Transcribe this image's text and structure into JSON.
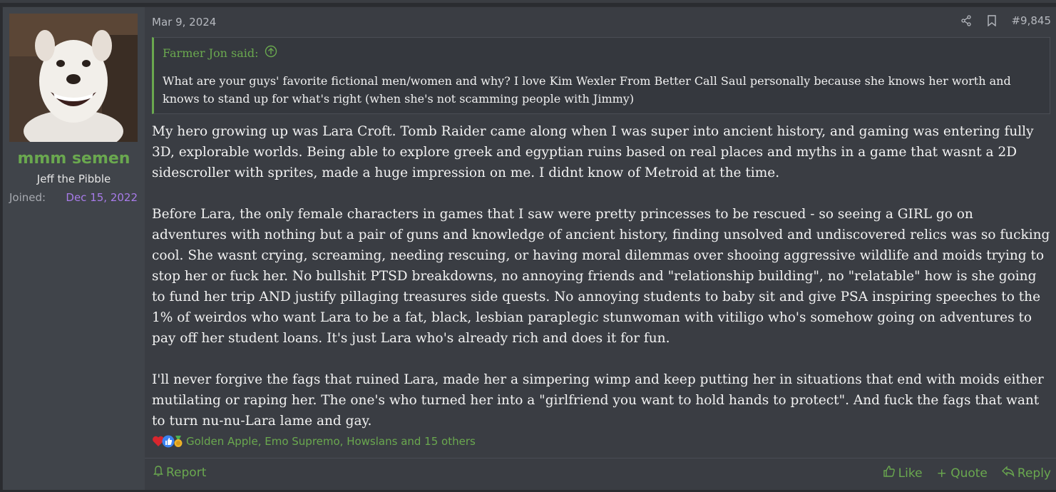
{
  "user": {
    "username": "mmm semen",
    "title": "Jeff the Pibble",
    "joined_label": "Joined:",
    "joined_date": "Dec 15, 2022"
  },
  "post": {
    "date": "Mar 9, 2024",
    "number": "#9,845",
    "quote": {
      "author": "Farmer Jon said:",
      "text": "What are your guys' favorite fictional men/women and why? I love Kim Wexler From Better Call Saul personally because she knows her worth and knows to stand up for what's right (when she's not scamming people with Jimmy)"
    },
    "paragraphs": [
      "My hero growing up was Lara Croft. Tomb Raider came along when I was super into ancient history, and gaming was entering fully 3D, explorable worlds. Being able to explore greek and egyptian ruins based on real places and myths in a game that wasnt a 2D sidescroller with sprites, made a huge impression on me. I didnt know of Metroid at the time.",
      "Before Lara, the only female characters in games that I saw were pretty princesses to be rescued - so seeing a GIRL go on adventures with nothing but a pair of guns and knowledge of ancient history, finding unsolved and undiscovered relics was so fucking cool. She wasnt crying, screaming, needing rescuing, or having moral dilemmas over shooing aggressive wildlife and moids trying to stop her or fuck her. No bullshit PTSD breakdowns, no annoying friends and \"relationship building\", no \"relatable\" how is she going to fund her trip AND justify pillaging treasures side quests. No annoying students to baby sit and give PSA inspiring speeches to the 1% of weirdos who want Lara to be a fat, black, lesbian paraplegic stunwoman with vitiligo who's somehow going on adventures to pay off her student loans. It's just Lara who's already rich and does it for fun.",
      "I'll never forgive the fags that ruined Lara, made her a simpering wimp and keep putting her in situations that end with moids either mutilating or raping her. The one's who turned her into a \"girlfriend you want to hold hands to protect\". And fuck the fags that want to turn nu-nu-Lara lame and gay."
    ],
    "reactions_text": "Golden Apple, Emo Supremo, Howslans and 15 others"
  },
  "footer": {
    "report_label": "Report",
    "like_label": "Like",
    "quote_label": "+ Quote",
    "reply_label": "Reply"
  },
  "colors": {
    "accent_green": "#6aa84f",
    "joined_date_purple": "#a77be8",
    "background": "#3a3d43",
    "user_column": "#40444a"
  },
  "icons": [
    "share-icon",
    "bookmark-icon",
    "arrow-up-circle-icon",
    "heart-reaction-icon",
    "thumbs-up-reaction-icon",
    "medal-reaction-icon",
    "report-icon",
    "like-icon",
    "reply-icon"
  ]
}
